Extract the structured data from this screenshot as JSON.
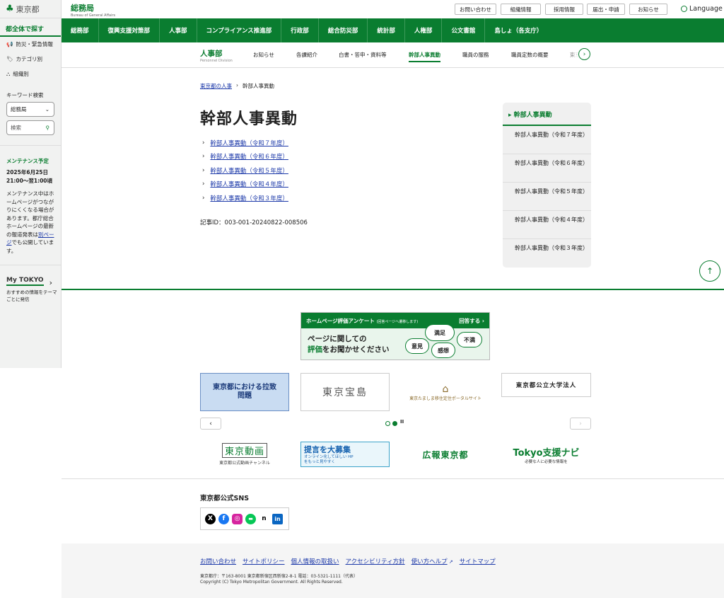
{
  "sidebar": {
    "logo": "東京都",
    "explore": "都全体で探す",
    "links": [
      "防災・緊急情報",
      "カテゴリ別",
      "組織別"
    ],
    "keyword_label": "キーワード検索",
    "bureau_select": "総務局",
    "search_placeholder": "検索",
    "maintenance_title": "メンテナンス予定",
    "maintenance_date1": "2025年6月25日",
    "maintenance_date2": "21:00～翌1:00頃",
    "maintenance_text_before": "メンテナンス中はホームページがつながりにくくなる場合があります。都庁総合ホームページの最新の報道発表は",
    "maintenance_link": "別ページ",
    "maintenance_text_after": "でも公開しています。",
    "mytokyo_logo": "My TOKYO",
    "mytokyo_text": "おすすめの情報をテーマごとに発信"
  },
  "header": {
    "site_title": "総務局",
    "site_title_en": "Bureau of General Affairs",
    "utility": [
      "お問い合わせ",
      "組織情報",
      "採用情報",
      "届出・申請",
      "お知らせ"
    ],
    "language": "Language"
  },
  "gnav": [
    "総務部",
    "復興支援対策部",
    "人事部",
    "コンプライアンス推進部",
    "行政部",
    "総合防災部",
    "統計部",
    "人権部",
    "公文書館",
    "島しょ（各支庁）"
  ],
  "subnav": {
    "dept": "人事部",
    "dept_en": "Personnel Division",
    "items": [
      "お知らせ",
      "各課紹介",
      "白書・答申・資料等",
      "幹部人事異動",
      "職員の服務",
      "職員定数の概要",
      "東京"
    ]
  },
  "breadcrumb": {
    "parent": "東京都の人事",
    "separator": "›",
    "current": "幹部人事異動"
  },
  "page_title": "幹部人事異動",
  "articles": [
    "幹部人事異動（令和７年度）",
    "幹部人事異動（令和６年度）",
    "幹部人事異動（令和５年度）",
    "幹部人事異動（令和４年度）",
    "幹部人事異動（令和３年度）"
  ],
  "article_id": "記事ID：003-001-20240822-008506",
  "localnav": {
    "title": "幹部人事異動",
    "items": [
      "幹部人事異動（令和７年度）",
      "幹部人事異動（令和６年度）",
      "幹部人事異動（令和５年度）",
      "幹部人事異動（令和４年度）",
      "幹部人事異動（令和３年度）"
    ]
  },
  "survey": {
    "head": "ホームページ評価アンケート",
    "head_small": "(回答ページへ遷移します)",
    "answer": "回答する",
    "line1": "ページに関しての",
    "line2_hl": "評価",
    "line2_rest": "をお聞かせください",
    "bubbles": [
      "満足",
      "意見",
      "感想",
      "不満"
    ]
  },
  "banners_row1": [
    "東京都における拉致問題",
    "東京宝島",
    "東京たましま移住定住ポータルサイト",
    "東京都公立大学法人"
  ],
  "banners_row2": [
    "東京動画",
    "東京都公式動画チャンネル",
    "提言を大募集",
    "オンライン化してほしい HPをもっと見やすく",
    "広報東京都",
    "Tokyo支援ナビ",
    "必要な人に必要な情報を"
  ],
  "sns": {
    "title": "東京都公式SNS",
    "icons": [
      "x-icon",
      "facebook-icon",
      "instagram-icon",
      "line-icon",
      "note-icon",
      "linkedin-icon"
    ]
  },
  "footer": {
    "links": [
      "お問い合わせ",
      "サイトポリシー",
      "個人情報の取扱い",
      "アクセシビリティ方針",
      "使い方ヘルプ",
      "サイトマップ"
    ],
    "address": "東京都庁：〒163-8001 東京都新宿区西新宿2-8-1 電話：03-5321-1111（代表）",
    "copyright": "Copyright (C) Tokyo Metropolitan Government. All Rights Reserved."
  },
  "colors": {
    "brand_green": "#0a7d30",
    "link_blue": "#1a37a8"
  }
}
